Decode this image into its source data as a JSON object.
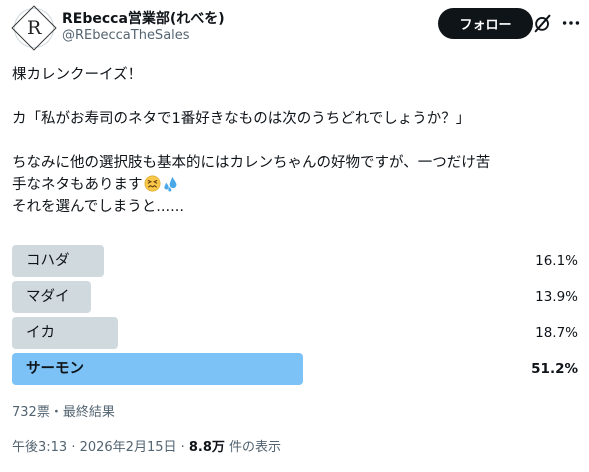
{
  "author": {
    "avatar_letter": "R",
    "display_name": "REbecca営業部(れべを)",
    "handle": "@REbeccaTheSales"
  },
  "actions": {
    "follow_label": "フォロー",
    "grok_icon": "grok-icon",
    "more_icon": "more-horizontal-icon"
  },
  "tweet": {
    "line1": "棵カレンクーイズ！",
    "line2": "カ「私がお寿司のネタで1番好きなものは次のうちどれでしょうか？」",
    "line3": "ちなみに他の選択肢も基本的にはカレンちゃんの好物ですが、一つだけ苦",
    "line4": "手なネタもあります",
    "line5": "それを選んでしまうと......",
    "emojis": [
      "confounded-face-emoji",
      "sweat-droplets-emoji"
    ]
  },
  "poll": {
    "options": [
      {
        "label": "コハダ",
        "percent": "16.1%",
        "value": 16.1
      },
      {
        "label": "マダイ",
        "percent": "13.9%",
        "value": 13.9
      },
      {
        "label": "イカ",
        "percent": "18.7%",
        "value": 18.7
      },
      {
        "label": "サーモン",
        "percent": "51.2%",
        "value": 51.2
      }
    ],
    "summary": "732票・最終結果",
    "bar_color": "#cfd9de",
    "winner_color": "#7cc2f6"
  },
  "meta": {
    "timestamp": "午後3:13 · 2026年2月15日 · ",
    "views_count": "8.8万",
    "views_label": " 件の表示"
  }
}
